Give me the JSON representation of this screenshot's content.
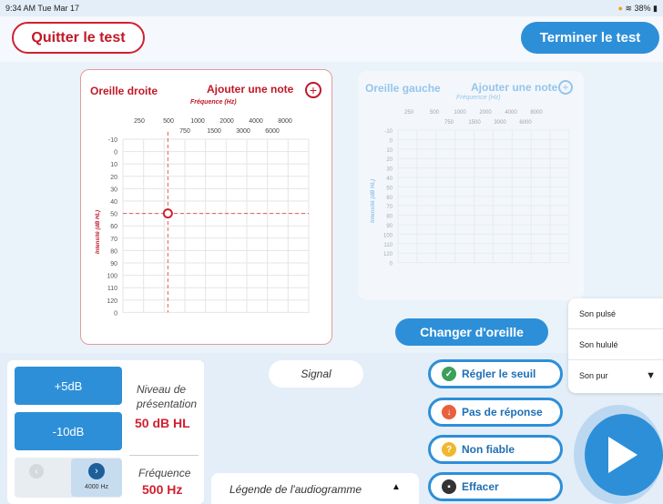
{
  "status": {
    "time": "9:34 AM  Tue Mar 17",
    "battery": "38%",
    "wifi": "wifi-icon"
  },
  "header": {
    "quit": "Quitter le test",
    "finish": "Terminer le test"
  },
  "right_ear": {
    "title": "Oreille droite",
    "add_note": "Ajouter une note",
    "freq_label": "Fréquence (Hz)",
    "freqs_top": [
      "250",
      "500",
      "1000",
      "2000",
      "4000",
      "8000"
    ],
    "freqs_mid": [
      "750",
      "1500",
      "3000",
      "6000"
    ],
    "y_label": "Intensité (dB HL)",
    "levels": [
      "-10",
      "0",
      "10",
      "20",
      "30",
      "40",
      "50",
      "60",
      "70",
      "80",
      "90",
      "100",
      "110",
      "120",
      "0"
    ]
  },
  "left_ear": {
    "title": "Oreille gauche",
    "add_note": "Ajouter une note",
    "freq_label": "Fréquence (Hz)",
    "freqs_top": [
      "250",
      "500",
      "1000",
      "2000",
      "4000",
      "8000"
    ],
    "freqs_mid": [
      "750",
      "1500",
      "3000",
      "6000"
    ],
    "y_label": "Intensité (dB HL)",
    "levels": [
      "-10",
      "0",
      "10",
      "20",
      "30",
      "40",
      "50",
      "60",
      "70",
      "80",
      "90",
      "100",
      "110",
      "120",
      "0"
    ]
  },
  "change_ear": "Changer d'oreille",
  "controls": {
    "plus5": "+5dB",
    "minus10": "-10dB",
    "level_label": "Niveau de présentation",
    "level_value": "50 dB HL",
    "freq_label": "Fréquence",
    "freq_value": "500 Hz",
    "freq_next": "4000 Hz"
  },
  "signal": "Signal",
  "legend": "Légende de l'audiogramme",
  "actions": {
    "set_threshold": "Régler le seuil",
    "no_response": "Pas de réponse",
    "unreliable": "Non fiable",
    "erase": "Effacer"
  },
  "sound_menu": {
    "pulsed": "Son pulsé",
    "warble": "Son hululé",
    "pure": "Son pur"
  },
  "colors": {
    "accent": "#2d8fd8",
    "red": "#d02030",
    "green": "#3aa05a",
    "orange": "#e8603c",
    "yellow": "#f0b830"
  }
}
